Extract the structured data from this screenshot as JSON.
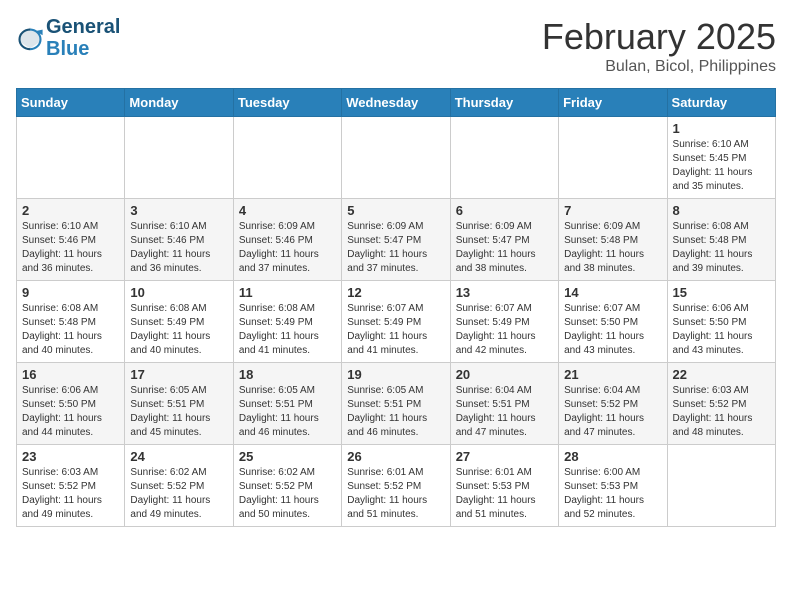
{
  "header": {
    "logo_line1": "General",
    "logo_line2": "Blue",
    "month_year": "February 2025",
    "location": "Bulan, Bicol, Philippines"
  },
  "weekdays": [
    "Sunday",
    "Monday",
    "Tuesday",
    "Wednesday",
    "Thursday",
    "Friday",
    "Saturday"
  ],
  "weeks": [
    [
      {
        "day": "",
        "text": ""
      },
      {
        "day": "",
        "text": ""
      },
      {
        "day": "",
        "text": ""
      },
      {
        "day": "",
        "text": ""
      },
      {
        "day": "",
        "text": ""
      },
      {
        "day": "",
        "text": ""
      },
      {
        "day": "1",
        "text": "Sunrise: 6:10 AM\nSunset: 5:45 PM\nDaylight: 11 hours and 35 minutes."
      }
    ],
    [
      {
        "day": "2",
        "text": "Sunrise: 6:10 AM\nSunset: 5:46 PM\nDaylight: 11 hours and 36 minutes."
      },
      {
        "day": "3",
        "text": "Sunrise: 6:10 AM\nSunset: 5:46 PM\nDaylight: 11 hours and 36 minutes."
      },
      {
        "day": "4",
        "text": "Sunrise: 6:09 AM\nSunset: 5:46 PM\nDaylight: 11 hours and 37 minutes."
      },
      {
        "day": "5",
        "text": "Sunrise: 6:09 AM\nSunset: 5:47 PM\nDaylight: 11 hours and 37 minutes."
      },
      {
        "day": "6",
        "text": "Sunrise: 6:09 AM\nSunset: 5:47 PM\nDaylight: 11 hours and 38 minutes."
      },
      {
        "day": "7",
        "text": "Sunrise: 6:09 AM\nSunset: 5:48 PM\nDaylight: 11 hours and 38 minutes."
      },
      {
        "day": "8",
        "text": "Sunrise: 6:08 AM\nSunset: 5:48 PM\nDaylight: 11 hours and 39 minutes."
      }
    ],
    [
      {
        "day": "9",
        "text": "Sunrise: 6:08 AM\nSunset: 5:48 PM\nDaylight: 11 hours and 40 minutes."
      },
      {
        "day": "10",
        "text": "Sunrise: 6:08 AM\nSunset: 5:49 PM\nDaylight: 11 hours and 40 minutes."
      },
      {
        "day": "11",
        "text": "Sunrise: 6:08 AM\nSunset: 5:49 PM\nDaylight: 11 hours and 41 minutes."
      },
      {
        "day": "12",
        "text": "Sunrise: 6:07 AM\nSunset: 5:49 PM\nDaylight: 11 hours and 41 minutes."
      },
      {
        "day": "13",
        "text": "Sunrise: 6:07 AM\nSunset: 5:49 PM\nDaylight: 11 hours and 42 minutes."
      },
      {
        "day": "14",
        "text": "Sunrise: 6:07 AM\nSunset: 5:50 PM\nDaylight: 11 hours and 43 minutes."
      },
      {
        "day": "15",
        "text": "Sunrise: 6:06 AM\nSunset: 5:50 PM\nDaylight: 11 hours and 43 minutes."
      }
    ],
    [
      {
        "day": "16",
        "text": "Sunrise: 6:06 AM\nSunset: 5:50 PM\nDaylight: 11 hours and 44 minutes."
      },
      {
        "day": "17",
        "text": "Sunrise: 6:05 AM\nSunset: 5:51 PM\nDaylight: 11 hours and 45 minutes."
      },
      {
        "day": "18",
        "text": "Sunrise: 6:05 AM\nSunset: 5:51 PM\nDaylight: 11 hours and 46 minutes."
      },
      {
        "day": "19",
        "text": "Sunrise: 6:05 AM\nSunset: 5:51 PM\nDaylight: 11 hours and 46 minutes."
      },
      {
        "day": "20",
        "text": "Sunrise: 6:04 AM\nSunset: 5:51 PM\nDaylight: 11 hours and 47 minutes."
      },
      {
        "day": "21",
        "text": "Sunrise: 6:04 AM\nSunset: 5:52 PM\nDaylight: 11 hours and 47 minutes."
      },
      {
        "day": "22",
        "text": "Sunrise: 6:03 AM\nSunset: 5:52 PM\nDaylight: 11 hours and 48 minutes."
      }
    ],
    [
      {
        "day": "23",
        "text": "Sunrise: 6:03 AM\nSunset: 5:52 PM\nDaylight: 11 hours and 49 minutes."
      },
      {
        "day": "24",
        "text": "Sunrise: 6:02 AM\nSunset: 5:52 PM\nDaylight: 11 hours and 49 minutes."
      },
      {
        "day": "25",
        "text": "Sunrise: 6:02 AM\nSunset: 5:52 PM\nDaylight: 11 hours and 50 minutes."
      },
      {
        "day": "26",
        "text": "Sunrise: 6:01 AM\nSunset: 5:52 PM\nDaylight: 11 hours and 51 minutes."
      },
      {
        "day": "27",
        "text": "Sunrise: 6:01 AM\nSunset: 5:53 PM\nDaylight: 11 hours and 51 minutes."
      },
      {
        "day": "28",
        "text": "Sunrise: 6:00 AM\nSunset: 5:53 PM\nDaylight: 11 hours and 52 minutes."
      },
      {
        "day": "",
        "text": ""
      }
    ]
  ]
}
